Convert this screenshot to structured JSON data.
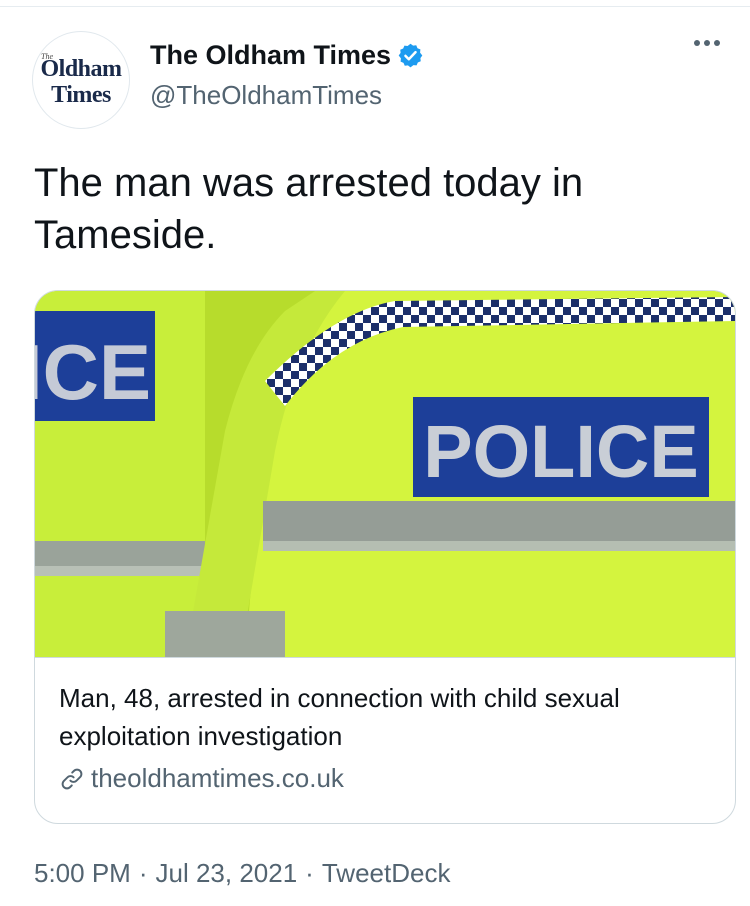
{
  "avatar": {
    "logo_small": "The",
    "logo_line1": "Oldham",
    "logo_line2": "Times"
  },
  "account": {
    "display_name": "The Oldham Times",
    "handle": "@TheOldhamTimes",
    "verified": true
  },
  "tweet": {
    "text": "The man was arrested today in Tameside."
  },
  "card": {
    "image_text_main": "POLICE",
    "image_text_partial": "ICE",
    "title": "Man, 48, arrested in connection with child sexual exploitation investigation",
    "url": "theoldhamtimes.co.uk"
  },
  "meta": {
    "time": "5:00 PM",
    "date": "Jul 23, 2021",
    "source": "TweetDeck",
    "separator": "·"
  },
  "icons": {
    "verified": "verified-badge-icon",
    "more": "more-options-icon",
    "link": "link-icon"
  },
  "colors": {
    "verified": "#1d9bf0",
    "text": "#0f1419",
    "secondary": "#536471",
    "border": "#cfd9de",
    "hi_vis": "#c9f23a",
    "police_blue": "#1c3f9a"
  }
}
